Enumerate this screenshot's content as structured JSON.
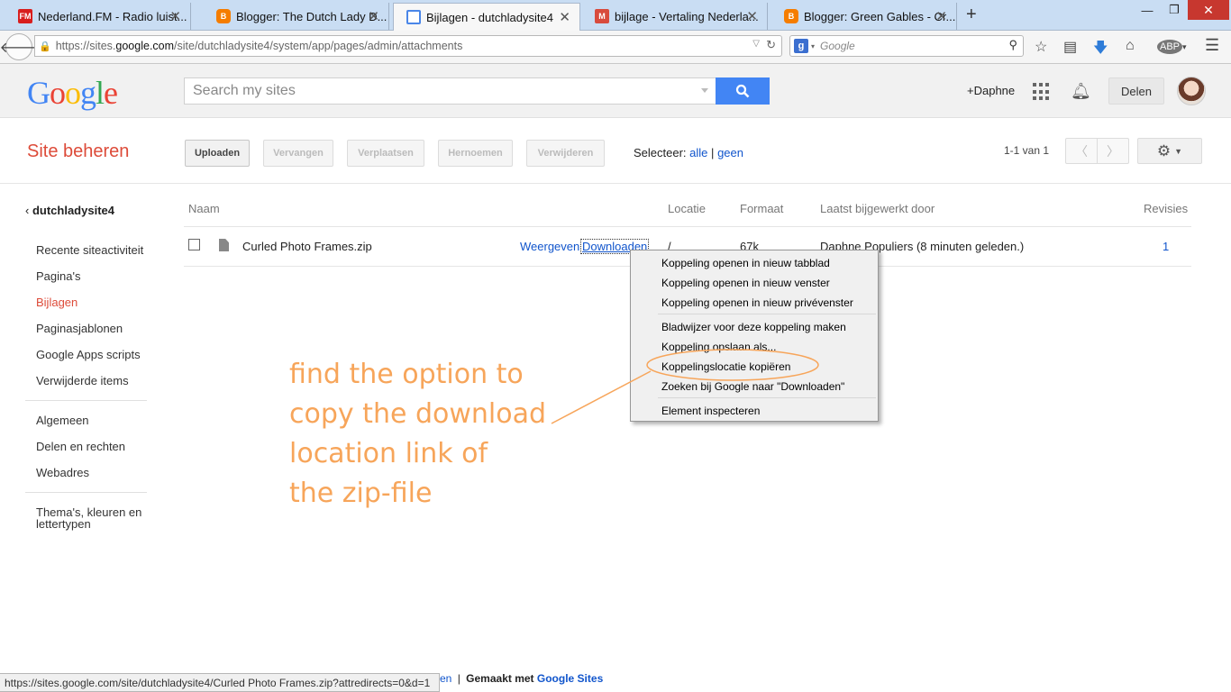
{
  "tabs": [
    {
      "title": "Nederland.FM - Radio luist...",
      "favicon": "fm-icon",
      "color": "#d81e1e"
    },
    {
      "title": "Blogger: The Dutch Lady D...",
      "favicon": "blogger-icon",
      "color": "#f57d00"
    },
    {
      "title": "Bijlagen - dutchladysite4",
      "favicon": "sites-icon",
      "color": "#4a86e8",
      "active": true
    },
    {
      "title": "bijlage - Vertaling Nederla...",
      "favicon": "m-icon",
      "color": "#d84b3d"
    },
    {
      "title": "Blogger: Green Gables - Cr...",
      "favicon": "blogger-icon",
      "color": "#f57d00"
    }
  ],
  "browser": {
    "url_prefix": "https://sites.",
    "url_domain": "google.com",
    "url_path": "/site/dutchladysite4/system/app/pages/admin/attachments",
    "search_engine": "Google",
    "fav_labels": [
      "FM",
      "B",
      "",
      "M",
      "B"
    ]
  },
  "gbar": {
    "logo": "Google",
    "search_placeholder": "Search my sites",
    "user": "+Daphne",
    "share": "Delen"
  },
  "manage": {
    "title": "Site beheren",
    "buttons": {
      "upload": "Uploaden",
      "replace": "Vervangen",
      "move": "Verplaatsen",
      "rename": "Hernoemen",
      "delete": "Verwijderen"
    },
    "select_label": "Selecteer:",
    "select_all": "alle",
    "select_sep": "|",
    "select_none": "geen",
    "page_count": "1-1 van 1"
  },
  "sidebar": {
    "site_name": "dutchladysite4",
    "group1": [
      "Recente siteactiviteit",
      "Pagina's",
      "Bijlagen",
      "Paginasjablonen",
      "Google Apps scripts",
      "Verwijderde items"
    ],
    "group2": [
      "Algemeen",
      "Delen en rechten",
      "Webadres"
    ],
    "group3": [
      "Thema's, kleuren en",
      "lettertypen"
    ],
    "selected": "Bijlagen"
  },
  "table": {
    "headers": {
      "name": "Naam",
      "location": "Locatie",
      "format": "Formaat",
      "updated_by": "Laatst bijgewerkt door",
      "revisions": "Revisies"
    },
    "rows": [
      {
        "name": "Curled Photo Frames.zip",
        "view": "Weergeven",
        "download": "Downloaden",
        "location": "/",
        "format": "67k",
        "updated_by": "Daphne Populiers (8 minuten geleden.)",
        "revisions": "1"
      }
    ]
  },
  "context_menu": {
    "items": [
      "Koppeling openen in nieuw tabblad",
      "Koppeling openen in nieuw venster",
      "Koppeling openen in nieuw privévenster",
      "Bladwijzer voor deze koppeling maken",
      "Koppeling opslaan als...",
      "Koppelingslocatie kopiëren",
      "Zoeken bij Google naar \"Downloaden\"",
      "Element inspecteren"
    ],
    "highlighted": "Koppelingslocatie kopiëren"
  },
  "annotation": {
    "lines": [
      "find the option to",
      "copy the download",
      "location link of",
      "the zip-file"
    ],
    "color": "#f7a55a"
  },
  "status": {
    "url": "https://sites.google.com/site/dutchladysite4/Curled Photo Frames.zip?attredirects=0&d=1"
  },
  "footer": {
    "partial": "en",
    "sep": "|",
    "made_with": "Gemaakt met",
    "sites_link": "Google Sites"
  },
  "colors": {
    "accent_red": "#dd4b39",
    "link_blue": "#1155cc",
    "google_blue": "#4285f4"
  }
}
